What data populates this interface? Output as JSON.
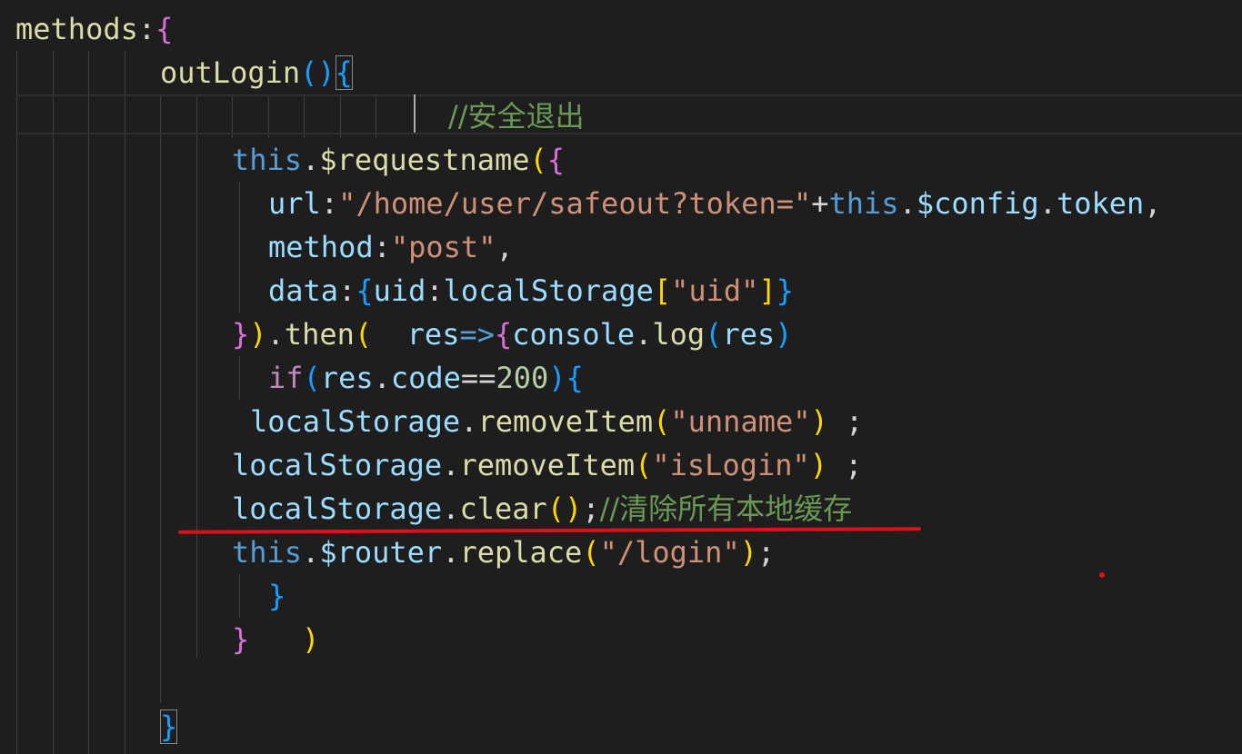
{
  "code": {
    "l00": {
      "a": "methods",
      "b": ":",
      "c": "{"
    },
    "l01": {
      "a": "outLogin",
      "b": "(",
      "c": ")",
      "d": "{"
    },
    "l02": {
      "a": "//安全退出"
    },
    "l03": {
      "a": "this",
      "b": ".",
      "c": "$requestname",
      "d": "(",
      "e": "{"
    },
    "l04": {
      "a": "url",
      "b": ":",
      "c": "\"/home/user/safeout?token=\"",
      "d": "+",
      "e": "this",
      "f": ".",
      "g": "$config",
      "h": ".",
      "i": "token",
      "j": ","
    },
    "l05": {
      "a": "method",
      "b": ":",
      "c": "\"post\"",
      "d": ","
    },
    "l06": {
      "a": "data",
      "b": ":",
      "c": "{",
      "d": "uid",
      "e": ":",
      "f": "localStorage",
      "g": "[",
      "h": "\"uid\"",
      "i": "]",
      "j": "}"
    },
    "l07": {
      "a": "}",
      "b": ")",
      "c": ".",
      "d": "then",
      "e": "(",
      "f": "  ",
      "g": "res",
      "h": "=>",
      "i": "{",
      "j": "console",
      "k": ".",
      "l": "log",
      "m": "(",
      "n": "res",
      "o": ")"
    },
    "l08": {
      "a": "if",
      "b": "(",
      "c": "res",
      "d": ".",
      "e": "code",
      "f": "==",
      "g": "200",
      "h": ")",
      "i": "{"
    },
    "l09": {
      "a": "localStorage",
      "b": ".",
      "c": "removeItem",
      "d": "(",
      "e": "\"unname\"",
      "f": ")",
      "g": " ;"
    },
    "l10": {
      "a": "localStorage",
      "b": ".",
      "c": "removeItem",
      "d": "(",
      "e": "\"isLogin\"",
      "f": ")",
      "g": " ;"
    },
    "l11": {
      "a": "localStorage",
      "b": ".",
      "c": "clear",
      "d": "(",
      "e": ")",
      "f": ";",
      "g": "//清除所有本地缓存"
    },
    "l12": {
      "a": "this",
      "b": ".",
      "c": "$router",
      "d": ".",
      "e": "replace",
      "f": "(",
      "g": "\"/login\"",
      "h": ")",
      "i": ";"
    },
    "l13": {
      "a": "}"
    },
    "l14": {
      "a": "}",
      "b": "   ",
      "c": ")"
    },
    "l15": {
      "a": "}"
    }
  },
  "colors": {
    "background": "#1e1e1e",
    "keyword": "#569cd6",
    "control": "#c586c0",
    "property": "#9cdcfe",
    "function": "#dcdcaa",
    "string": "#ce9178",
    "number": "#b5cea8",
    "comment": "#6a9955",
    "bracket_gold": "#ffd700",
    "bracket_orchid": "#da70d6",
    "bracket_blue": "#179fff",
    "annotation_red": "#e0101a"
  }
}
